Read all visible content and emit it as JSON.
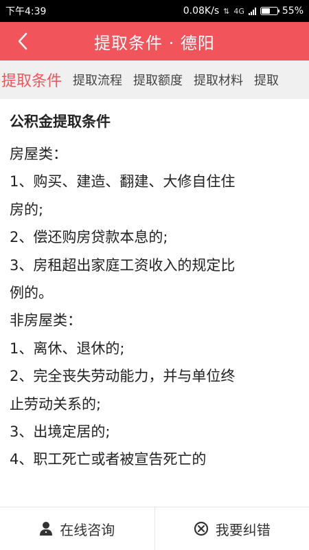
{
  "status_bar": {
    "time": "下午4:39",
    "network_speed": "0.08K/s",
    "network_type": "4G",
    "battery_percent": "55%",
    "battery_level": 0.55
  },
  "header": {
    "title": "提取条件 · 德阳",
    "back_icon": "chevron-left-icon"
  },
  "tabs": [
    {
      "label": "提取条件",
      "active": true
    },
    {
      "label": "提取流程",
      "active": false
    },
    {
      "label": "提取额度",
      "active": false
    },
    {
      "label": "提取材料",
      "active": false
    },
    {
      "label": "提取",
      "active": false
    }
  ],
  "content": {
    "section_title": "公积金提取条件",
    "lines": [
      "房屋类：",
      "1、购买、建造、翻建、大修自住住",
      "房的;",
      "2、偿还购房贷款本息的;",
      "3、房租超出家庭工资收入的规定比",
      "例的。",
      "非房屋类：",
      "1、离休、退休的;",
      "2、完全丧失劳动能力，并与单位终",
      "止劳动关系的;",
      "3、出境定居的;",
      "4、职工死亡或者被宣告死亡的"
    ]
  },
  "bottom_bar": {
    "consult_label": "在线咨询",
    "consult_icon": "person-icon",
    "report_label": "我要纠错",
    "report_icon": "error-circle-icon"
  },
  "colors": {
    "accent": "#f2545b",
    "tab_bg": "#f0f0f0",
    "text": "#222222"
  }
}
